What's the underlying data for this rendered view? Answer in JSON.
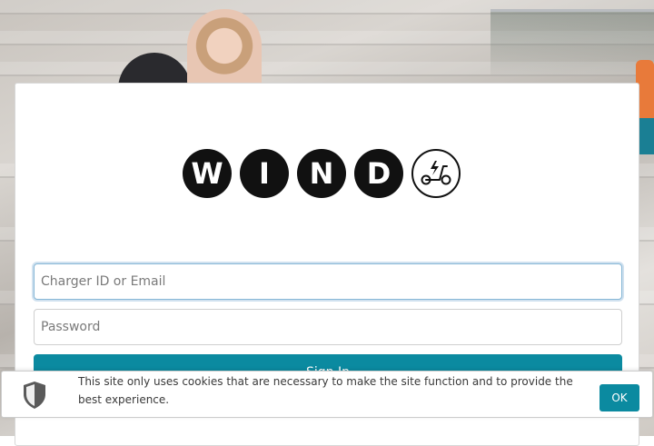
{
  "brand": {
    "letters": [
      "W",
      "I",
      "N",
      "D"
    ],
    "scooter_icon": "scooter-lightning-icon",
    "color": "#111111"
  },
  "login": {
    "email_placeholder": "Charger ID or Email",
    "email_value": "",
    "password_placeholder": "Password",
    "password_value": "",
    "submit_label": "Sign In"
  },
  "cookie_banner": {
    "icon": "shield-icon",
    "message": "This site only uses cookies that are necessary to make the site function and to provide the best experience.",
    "ok_label": "OK"
  },
  "colors": {
    "accent": "#0b8aa0",
    "focus_border": "#86b7d6"
  }
}
